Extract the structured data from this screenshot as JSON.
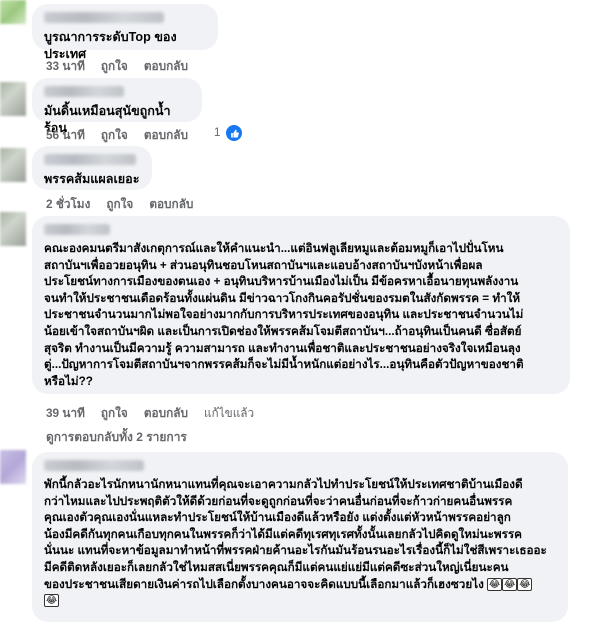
{
  "comments": [
    {
      "text": "บูรณาการระดับTop ของประเทศ",
      "time": "33 นาที",
      "like": "ถูกใจ",
      "reply": "ตอบกลับ"
    },
    {
      "text": "มันดิ้นเหมือนสุนัขถูกน้ำร้อน",
      "time": "56 นาที",
      "like": "ถูกใจ",
      "reply": "ตอบกลับ",
      "reaction_count": "1"
    },
    {
      "text": "พรรคส้มแผลเยอะ",
      "time": "2 ชั่วโมง",
      "like": "ถูกใจ",
      "reply": "ตอบกลับ"
    },
    {
      "text": "คณะองคมนตรีมาสังเกตุการณ์และให้คำแนะนำ...แต่อินฟลูเลียหมูและต้อมหมูก็เอาไปปั่นโหน\nสถาบันฯเพื่ออวยอนุทิน + ส่วนอนุทินชอบโหนสถาบันฯและแอบอ้างสถาบันฯบังหน้าเพื่อผล\nประโยชน์ทางการเมืองของตนเอง + อนุทินบริหารบ้านเมืองไม่เป็น มีข้อครหาเอื้อนายทุนพลังงาน\nจนทำให้ประชาชนเดือดร้อนทั้งแผ่นดิน มีข่าวฉาวโกงกินคอรัปชั่นของรมตในสังกัดพรรค = ทำให้\nประชาชนจำนวนมากไม่พอใจอย่างมากกับการบริหารประเทศของอนุทิน และประชาชนจำนวนไม่\nน้อยเข้าใจสถาบันฯผิด และเป็นการเปิดช่องให้พรรคส้มโจมตีสถาบันฯ...ถ้าอนุทินเป็นคนดี ซื่อสัตย์\nสุจริต ทำงานเป็นมีความรู้ ความสามารถ และทำงานเพื่อชาติและประชาชนอย่างจริงใจเหมือนลุง\nตู่...ปัญหาการโจมตีสถาบันฯจากพรรคส้มก็จะไม่มีน้ำหนักแต่อย่างไร...อนุทินคือตัวปัญหาของชาติ\nหรือไม่??",
      "time": "39 นาที",
      "like": "ถูกใจ",
      "reply": "ตอบกลับ",
      "edited": "แก้ไขแล้ว",
      "view_replies": "ดูการตอบกลับทั้ง 2 รายการ"
    },
    {
      "text": "พักนี้กลัวอะไรนักหนานักหนาแทนที่คุณจะเอาความกลัวไปทำประโยชน์ให้ประเทศชาติบ้านเมืองดี\nกว่าไหมและไปประพฤติตัวให้ดีด้วยก่อนที่จะดูถูกก่อนที่จะว่าคนอื่นก่อนที่จะก้าวก่ายคนอื่นพรรค\nคุณเองตัวคุณเองนั่นแหละทำประโยชน์ให้บ้านเมืองดีแล้วหรือยัง แต่งตั้งแต่หัวหน้าพรรคอย่าลูก\nน้องมีคดีกันทุกคนเกือบทุกคนในพรรคก็ว่าได้มีแต่คดีทุเรศทุเรศทั้งนั้นเลยกลัวไปคิดดูใหม่นะพรรค\nนั่นนะ แทนที่จะหาข้อมูลมาทำหน้าที่พรรคฝ่ายค้านอะไรกันมันร้อนรนอะไรเรื่องนี้ก็ไม่ใช่สีเพราะเธออะ\nมีคดีติดหลังเยอะก็เลยกลัวใช่ไหมสสเนี่ยพรรคคุณก็มีแต่คนแย่แย่มีแต่คดีซะส่วนใหญ่เนี่ยนะคน\nของประชาชนเสียดายเงินค่ารถไปเลือกตั้งบางคนอาจจะคิดแบบนี้เลือกมาแล้วก็เฮงซวยไง",
      "emoji": "😂"
    }
  ]
}
